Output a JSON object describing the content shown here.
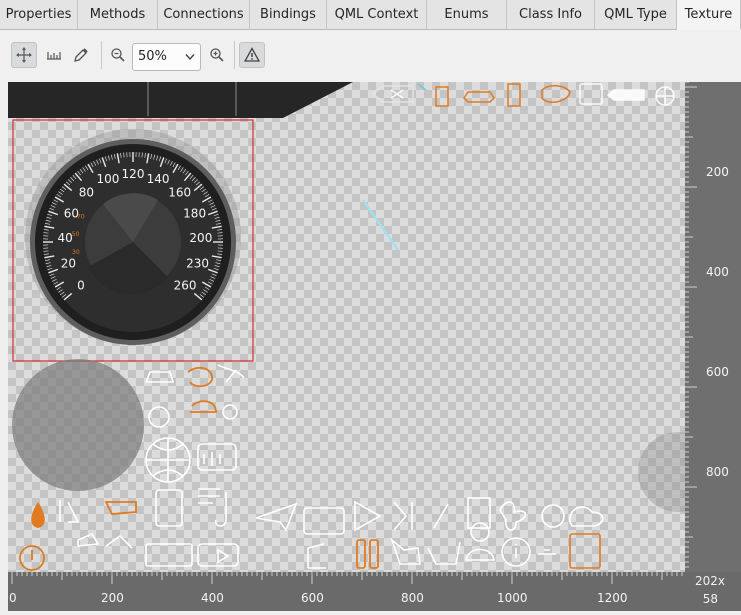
{
  "tabs": [
    {
      "label": "Properties",
      "width": 78
    },
    {
      "label": "Methods",
      "width": 80
    },
    {
      "label": "Connections",
      "width": 92
    },
    {
      "label": "Bindings",
      "width": 77
    },
    {
      "label": "QML Context",
      "width": 100
    },
    {
      "label": "Enums",
      "width": 80
    },
    {
      "label": "Class Info",
      "width": 88
    },
    {
      "label": "QML Type",
      "width": 82
    },
    {
      "label": "Texture",
      "width": 64,
      "active": true
    }
  ],
  "toolbar": {
    "zoom_value": "50%",
    "icons": [
      "move-icon",
      "measure-icon",
      "color-picker-icon",
      "zoom-out-icon",
      "zoom-in-icon",
      "warning-icon"
    ]
  },
  "speedometer": {
    "labels": [
      "0",
      "20",
      "40",
      "60",
      "80",
      "100",
      "120",
      "140",
      "160",
      "180",
      "200",
      "230",
      "260"
    ],
    "small_labels": [
      "30",
      "50",
      "70"
    ]
  },
  "rulers": {
    "horizontal": [
      "0",
      "200",
      "400",
      "600",
      "800",
      "1000",
      "1200"
    ],
    "vertical": [
      "200",
      "400",
      "600",
      "800"
    ]
  },
  "texture_size": {
    "width": "202x",
    "height": "58"
  },
  "colors": {
    "accent_orange": "#e07b22",
    "selection_red": "#d22f2f",
    "ruler_bg": "#6a6a6a"
  }
}
